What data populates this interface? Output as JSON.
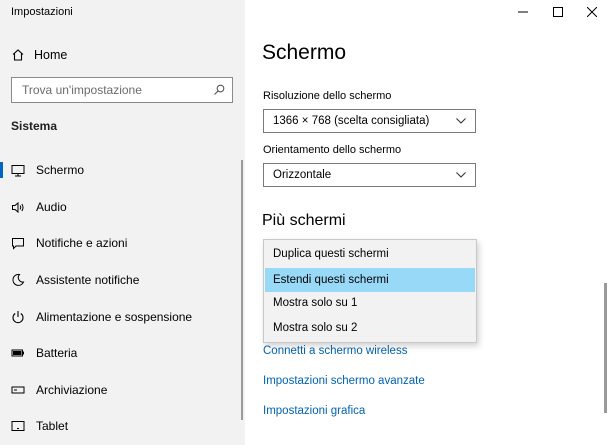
{
  "window": {
    "title": "Impostazioni"
  },
  "sidebar": {
    "home": {
      "label": "Home",
      "icon": "home-icon"
    },
    "search": {
      "placeholder": "Trova un'impostazione",
      "icon": "search-icon"
    },
    "section": "Sistema",
    "items": [
      {
        "label": "Schermo",
        "icon": "monitor-icon",
        "active": true
      },
      {
        "label": "Audio",
        "icon": "speaker-icon"
      },
      {
        "label": "Notifiche e azioni",
        "icon": "notification-icon"
      },
      {
        "label": "Assistente notifiche",
        "icon": "moon-icon"
      },
      {
        "label": "Alimentazione e sospensione",
        "icon": "power-icon"
      },
      {
        "label": "Batteria",
        "icon": "battery-icon"
      },
      {
        "label": "Archiviazione",
        "icon": "storage-icon"
      },
      {
        "label": "Tablet",
        "icon": "tablet-icon"
      }
    ]
  },
  "main": {
    "title": "Schermo",
    "resolution": {
      "label": "Risoluzione dello schermo",
      "value": "1366 × 768 (scelta consigliata)"
    },
    "orientation": {
      "label": "Orientamento dello schermo",
      "value": "Orizzontale"
    },
    "multi": {
      "title": "Più schermi",
      "options": [
        "Duplica questi schermi",
        "Estendi questi schermi",
        "Mostra solo su 1",
        "Mostra solo su 2"
      ],
      "selected_index": 1
    },
    "links": [
      "Connetti a schermo wireless",
      "Impostazioni schermo avanzate",
      "Impostazioni grafica"
    ]
  },
  "colors": {
    "accent": "#0067c0",
    "link": "#0063b1",
    "selection": "#99d9f8",
    "sidebar_bg": "#f2f2f2"
  }
}
